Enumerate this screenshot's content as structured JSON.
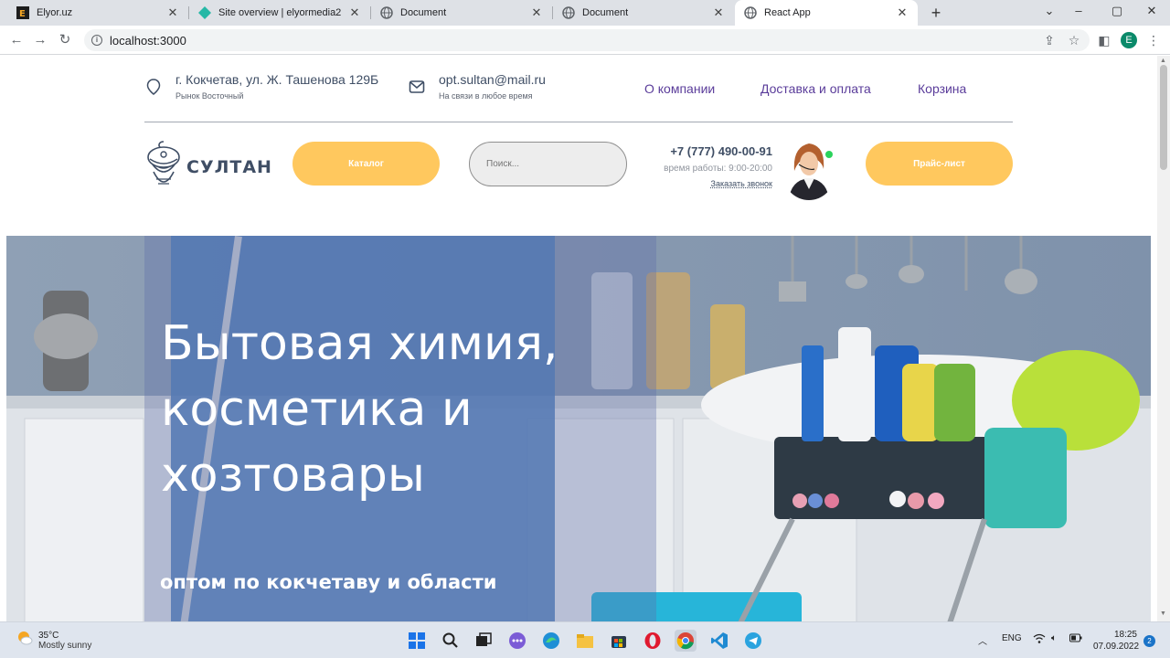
{
  "browser": {
    "tabs": [
      {
        "label": "Elyor.uz"
      },
      {
        "label": "Site overview | elyormedia2"
      },
      {
        "label": "Document"
      },
      {
        "label": "Document"
      },
      {
        "label": "React App"
      }
    ],
    "url": "localhost:3000",
    "profile_letter": "E"
  },
  "header": {
    "address": "г. Кокчетав, ул. Ж. Ташенова 129Б",
    "address_sub": "Рынок Восточный",
    "email": "opt.sultan@mail.ru",
    "email_sub": "На связи в любое время",
    "nav": [
      "О компании",
      "Доставка и оплата",
      "Корзина"
    ],
    "logo_text": "СУЛТАН",
    "catalog_label": "Каталог",
    "search_placeholder": "Поиск...",
    "phone": "+7 (777) 490-00-91",
    "hours": "время работы: 9:00-20:00",
    "callback": "Заказать звонок",
    "price_label": "Прайс-лист"
  },
  "hero": {
    "title_lines": [
      "Бытовая химия,",
      "косметика и",
      "хозтовары"
    ],
    "subtitle": "оптом по кокчетаву и области"
  },
  "taskbar": {
    "temperature": "35°C",
    "weather": "Mostly sunny",
    "language": "ENG",
    "time": "18:25",
    "date": "07.09.2022",
    "notifications": "2"
  },
  "colors": {
    "accent": "#ffc85e",
    "nav": "#5a3c9a",
    "text": "#3f4e65"
  }
}
